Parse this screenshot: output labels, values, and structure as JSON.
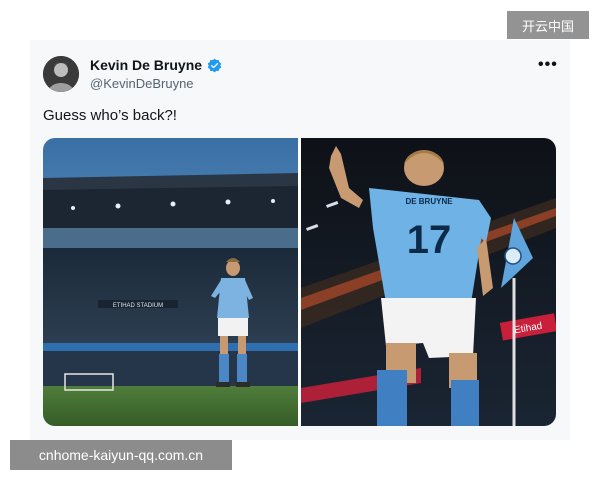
{
  "watermark_top": "开云中国",
  "watermark_bottom": "cnhome-kaiyun-qq.com.cn",
  "tweet": {
    "display_name": "Kevin De Bruyne",
    "handle": "@KevinDeBruyne",
    "text": "Guess who’s back?!",
    "more_icon": "more-icon",
    "verified_icon": "verified-badge-icon",
    "verified_color": "#1d9bf0"
  },
  "media": {
    "left_photo": {
      "banner_text": "ETIHAD STADIUM"
    },
    "right_photo": {
      "shirt_name": "DE BRUYNE",
      "shirt_number": "17",
      "ad_text": "Etihad"
    }
  }
}
